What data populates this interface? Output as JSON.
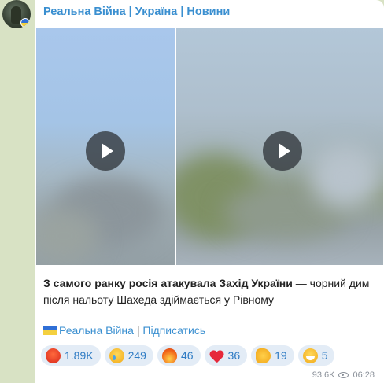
{
  "channel": {
    "title": "Реальна Війна | Україна | Новини"
  },
  "media": {
    "videos": [
      {
        "icon": "play-icon"
      },
      {
        "icon": "play-icon"
      }
    ]
  },
  "post": {
    "lead": "З самого ранку росія атакувала Захід України",
    "rest": " — чорний дим після нальоту Шахеда здіймається у Рівному"
  },
  "signature": {
    "channel_link": "Реальна Війна",
    "separator": " | ",
    "subscribe_link": "Підписатись"
  },
  "reactions": [
    {
      "icon": "angry-face-icon",
      "count": "1.89K"
    },
    {
      "icon": "sad-face-icon",
      "count": "249"
    },
    {
      "icon": "fire-icon",
      "count": "46"
    },
    {
      "icon": "heart-icon",
      "count": "36"
    },
    {
      "icon": "thumbs-up-icon",
      "count": "19"
    },
    {
      "icon": "grinning-face-icon",
      "count": "5"
    }
  ],
  "meta": {
    "views": "93.6K",
    "time": "06:28"
  },
  "colors": {
    "accent": "#3a8fd0",
    "reaction_bg": "#e3ecf6",
    "chat_bg": "#d8e2c4"
  }
}
